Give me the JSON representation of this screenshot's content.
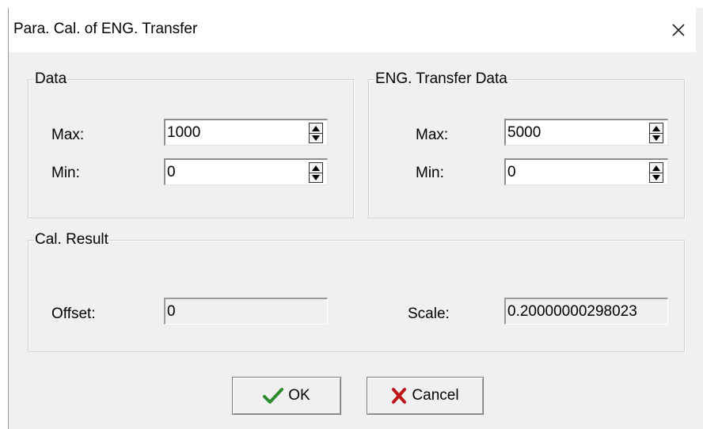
{
  "window": {
    "title": "Para. Cal. of ENG. Transfer",
    "close_symbol": "✕"
  },
  "data_group": {
    "legend": "Data",
    "max_label": "Max:",
    "max_value": "1000",
    "min_label": "Min:",
    "min_value": "0"
  },
  "eng_group": {
    "legend": "ENG. Transfer Data",
    "max_label": "Max:",
    "max_value": "5000",
    "min_label": "Min:",
    "min_value": "0"
  },
  "result_group": {
    "legend": "Cal. Result",
    "offset_label": "Offset:",
    "offset_value": "0",
    "scale_label": "Scale:",
    "scale_value": "0.20000000298023"
  },
  "buttons": {
    "ok_label": "OK",
    "ok_icon": "checkmark-icon",
    "ok_icon_color": "#2e8b2e",
    "cancel_label": "Cancel",
    "cancel_icon": "x-mark-icon",
    "cancel_icon_color": "#c01818"
  }
}
